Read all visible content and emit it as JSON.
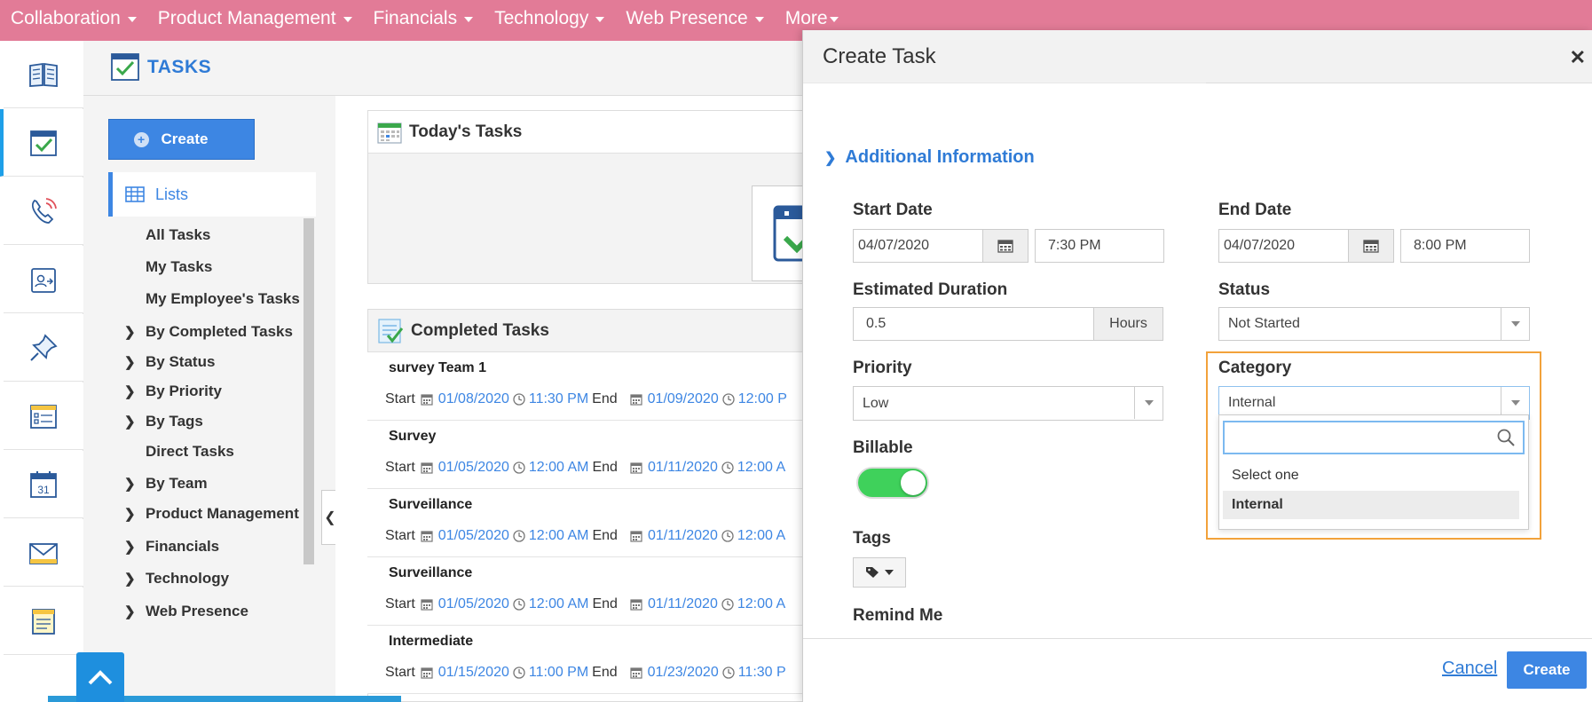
{
  "top_nav": {
    "items": [
      {
        "label": "Collaboration"
      },
      {
        "label": "Product Management"
      },
      {
        "label": "Financials"
      },
      {
        "label": "Technology"
      },
      {
        "label": "Web Presence"
      },
      {
        "label": "More"
      }
    ]
  },
  "rail": {
    "icons": [
      "book-icon",
      "tasks-icon",
      "phone-icon",
      "contact-card-icon",
      "pin-icon",
      "list-form-icon",
      "calendar-icon",
      "mail-icon",
      "notes-icon"
    ],
    "calendar_day": "31",
    "active": "tasks-icon"
  },
  "header": {
    "title": "TASKS"
  },
  "sidebar": {
    "create_label": "Create",
    "lists_label": "Lists",
    "items": [
      {
        "label": "All Tasks",
        "expandable": false
      },
      {
        "label": "My Tasks",
        "expandable": false
      },
      {
        "label": "My Employee's Tasks",
        "expandable": false
      },
      {
        "label": "By Completed Tasks",
        "expandable": true
      },
      {
        "label": "By Status",
        "expandable": true
      },
      {
        "label": "By Priority",
        "expandable": true
      },
      {
        "label": "By Tags",
        "expandable": true
      },
      {
        "label": "Direct Tasks",
        "expandable": false
      },
      {
        "label": "By Team",
        "expandable": true
      },
      {
        "label": "Product Management",
        "expandable": true
      },
      {
        "label": "Financials",
        "expandable": true
      },
      {
        "label": "Technology",
        "expandable": true
      },
      {
        "label": "Web Presence",
        "expandable": true
      }
    ]
  },
  "todays_tasks": {
    "title": "Today's Tasks"
  },
  "completed_tasks": {
    "title": "Completed Tasks",
    "start_label": "Start",
    "end_label": "End",
    "rows": [
      {
        "name": "survey Team 1",
        "start_date": "01/08/2020",
        "start_time": "11:30 PM",
        "end_date": "01/09/2020",
        "end_time": "12:00 P"
      },
      {
        "name": "Survey",
        "start_date": "01/05/2020",
        "start_time": "12:00 AM",
        "end_date": "01/11/2020",
        "end_time": "12:00 A"
      },
      {
        "name": "Surveillance",
        "start_date": "01/05/2020",
        "start_time": "12:00 AM",
        "end_date": "01/11/2020",
        "end_time": "12:00 A"
      },
      {
        "name": "Surveillance",
        "start_date": "01/05/2020",
        "start_time": "12:00 AM",
        "end_date": "01/11/2020",
        "end_time": "12:00 A"
      },
      {
        "name": "Intermediate",
        "start_date": "01/15/2020",
        "start_time": "11:00 PM",
        "end_date": "01/23/2020",
        "end_time": "11:30 P"
      }
    ]
  },
  "modal": {
    "title": "Create Task",
    "section_title": "Additional Information",
    "start_date_label": "Start Date",
    "start_date": "04/07/2020",
    "start_time": "7:30 PM",
    "end_date_label": "End Date",
    "end_date": "04/07/2020",
    "end_time": "8:00 PM",
    "duration_label": "Estimated Duration",
    "duration_value": "0.5",
    "duration_unit": "Hours",
    "status_label": "Status",
    "status_value": "Not Started",
    "priority_label": "Priority",
    "priority_value": "Low",
    "category_label": "Category",
    "category_value": "Internal",
    "category_options": [
      "Select one",
      "Internal"
    ],
    "billable_label": "Billable",
    "billable_on": true,
    "tags_label": "Tags",
    "remind_label": "Remind Me",
    "cancel_label": "Cancel",
    "create_label": "Create"
  },
  "colors": {
    "nav_bg": "#e27b97",
    "accent": "#3d86e3",
    "toggle_on": "#3fd15b",
    "highlight": "#f2a23b"
  }
}
